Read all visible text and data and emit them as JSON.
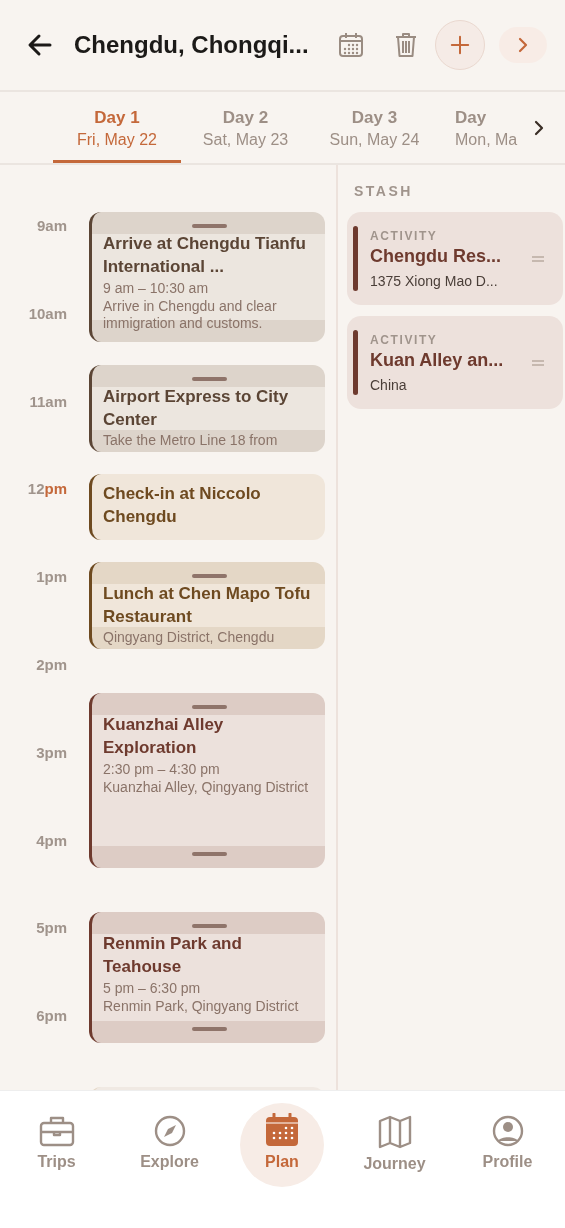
{
  "header": {
    "title": "Chengdu, Chongqi..."
  },
  "days": [
    {
      "day": "Day 1",
      "date": "Fri, May 22",
      "selected": true
    },
    {
      "day": "Day 2",
      "date": "Sat, May 23",
      "selected": false
    },
    {
      "day": "Day 3",
      "date": "Sun, May 24",
      "selected": false
    },
    {
      "day": "Day",
      "date": "Mon, Ma",
      "selected": false
    }
  ],
  "hours": [
    {
      "number": "9",
      "suffix": "am",
      "current": false
    },
    {
      "number": "10",
      "suffix": "am",
      "current": false
    },
    {
      "number": "11",
      "suffix": "am",
      "current": false
    },
    {
      "number": "12",
      "suffix": "pm",
      "current": true
    },
    {
      "number": "1",
      "suffix": "pm",
      "current": false
    },
    {
      "number": "2",
      "suffix": "pm",
      "current": false
    },
    {
      "number": "3",
      "suffix": "pm",
      "current": false
    },
    {
      "number": "4",
      "suffix": "pm",
      "current": false
    },
    {
      "number": "5",
      "suffix": "pm",
      "current": false
    },
    {
      "number": "6",
      "suffix": "pm",
      "current": false
    }
  ],
  "events": [
    {
      "title": "Arrive at Chengdu Tianfu International ...",
      "time": "9 am – 10:30 am",
      "details": "Arrive in Chengdu and clear immigration and customs.",
      "color": "#5b4535",
      "handles": true
    },
    {
      "title": "Airport Express to City Center",
      "details": "Take the Metro Line 18 from",
      "color": "#5b4535",
      "handles": true
    },
    {
      "title": "Check-in at Niccolo Chengdu",
      "color": "#6e4a20",
      "handles": false
    },
    {
      "title": "Lunch at Chen Mapo Tofu Restaurant",
      "details": "Qingyang District, Chengdu",
      "color": "#6e4a20",
      "handles": true
    },
    {
      "title": "Kuanzhai Alley Exploration",
      "time": "2:30 pm – 4:30 pm",
      "details": "Kuanzhai Alley, Qingyang District",
      "color": "#6e3a2e",
      "handles": true
    },
    {
      "title": "Renmin Park and Teahouse",
      "time": "5 pm – 6:30 pm",
      "details": "Renmin Park, Qingyang District",
      "color": "#6e3a2e",
      "handles": true
    },
    {
      "handles": false
    }
  ],
  "stash": {
    "heading": "STASH",
    "items": [
      {
        "type": "ACTIVITY",
        "title": "Chengdu Res...",
        "subtitle": "1375 Xiong Mao D..."
      },
      {
        "type": "ACTIVITY",
        "title": "Kuan Alley an...",
        "subtitle": "China"
      }
    ]
  },
  "nav": [
    {
      "label": "Trips",
      "selected": false
    },
    {
      "label": "Explore",
      "selected": false
    },
    {
      "label": "Plan",
      "selected": true
    },
    {
      "label": "Journey",
      "selected": false
    },
    {
      "label": "Profile",
      "selected": false
    }
  ]
}
